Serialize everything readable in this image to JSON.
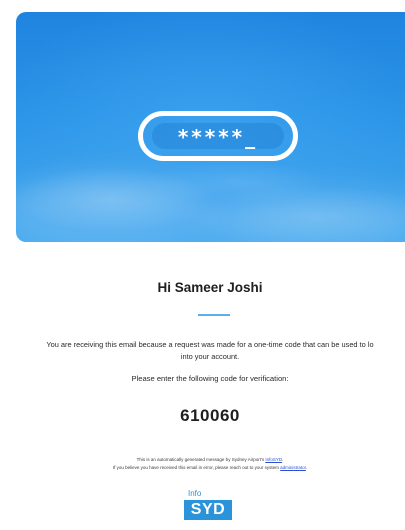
{
  "hero": {
    "icon": "masked-password-pill",
    "masked_text": "*****_",
    "background_color": "#2a94e6"
  },
  "email": {
    "greeting": "Hi Sameer Joshi",
    "body_line1": "You are receiving this email because a request was made for a one-time code that can be used to lo",
    "body_line2": "into your account.",
    "instruction": "Please enter the following code for verification:",
    "code": "610060",
    "footer_line1_prefix": "This is an automatically generated message by Sydney Airport's ",
    "footer_line1_link": "InfoSYD",
    "footer_line1_suffix": ".",
    "footer_line2_prefix": "If you believe you have received this email in error, please reach out to your system ",
    "footer_line2_link": "administrator",
    "footer_line2_suffix": "."
  },
  "logo": {
    "top_text": "Info",
    "box_text": "SYD",
    "brand_color": "#2b93da"
  },
  "accent_color": "#5ab0e8",
  "link_color": "#2d4fd6"
}
